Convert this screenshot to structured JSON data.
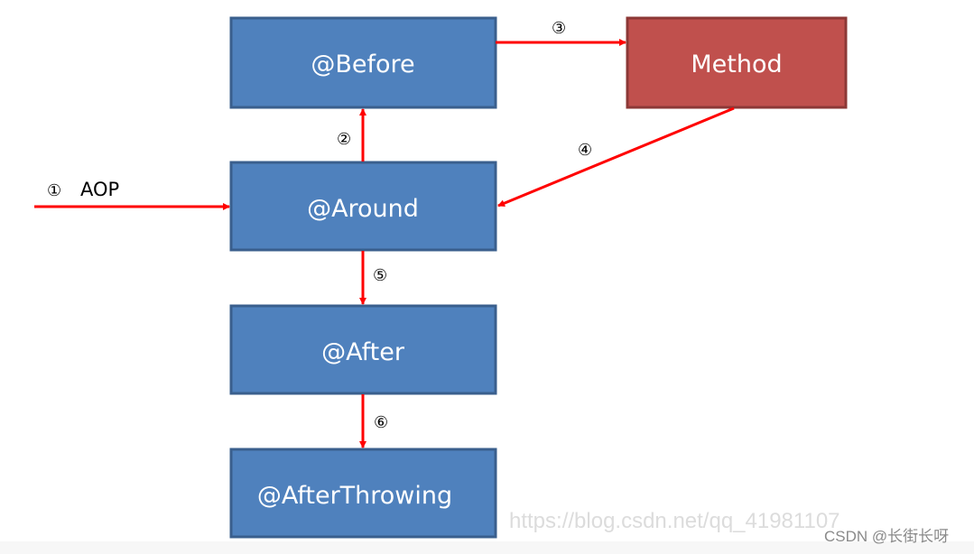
{
  "colors": {
    "advice_box": "#4f81bd",
    "advice_border": "#3a5f8d",
    "method_box": "#c0504d",
    "method_border": "#8c3836",
    "arrow": "#ff0000"
  },
  "boxes": {
    "before": "@Before",
    "method": "Method",
    "around": "@Around",
    "after": "@After",
    "after_throwing": "@AfterThrowing"
  },
  "steps": {
    "s1": "①",
    "s1_label": "AOP",
    "s2": "②",
    "s3": "③",
    "s4": "④",
    "s5": "⑤",
    "s6": "⑥"
  },
  "watermark": {
    "url": "https://blog.csdn.net/qq_41981107",
    "author": "CSDN @长街长呀"
  }
}
